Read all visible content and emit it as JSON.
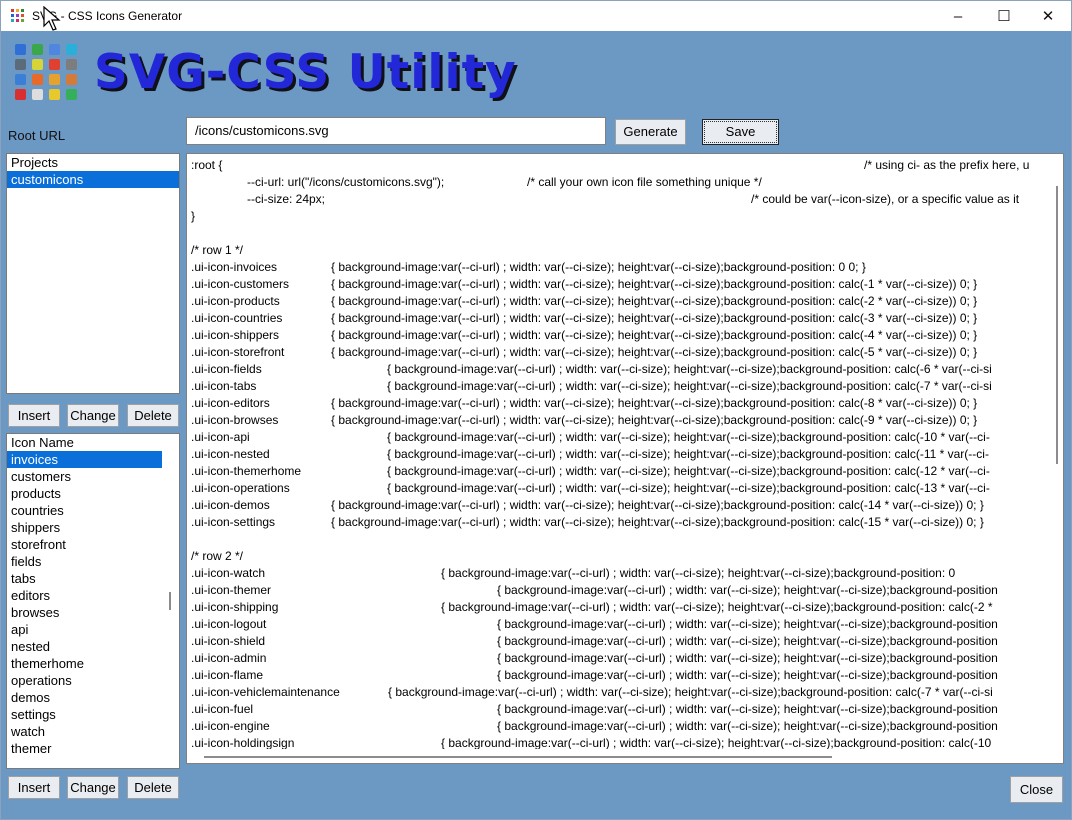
{
  "window": {
    "title": "SVG - CSS Icons Generator",
    "controls": {
      "minimize": "–",
      "maximize": "☐",
      "close": "✕"
    }
  },
  "hero": {
    "title": "SVG-CSS Utility"
  },
  "colors": {
    "background": "#6c98c4",
    "title": "#2227d8",
    "selection": "#0a6fd8"
  },
  "root_url": {
    "label": "Root URL",
    "value": "/icons/customicons.svg"
  },
  "buttons": {
    "generate": "Generate",
    "save": "Save",
    "insert": "Insert",
    "change": "Change",
    "delete": "Delete",
    "close": "Close"
  },
  "projects": {
    "items": [
      {
        "label": "Projects",
        "selected": false
      },
      {
        "label": "customicons",
        "selected": true
      }
    ]
  },
  "icons": {
    "items": [
      {
        "label": "Icon Name",
        "selected": false
      },
      {
        "label": "invoices",
        "selected": true
      },
      {
        "label": "customers",
        "selected": false
      },
      {
        "label": "products",
        "selected": false
      },
      {
        "label": "countries",
        "selected": false
      },
      {
        "label": "shippers",
        "selected": false
      },
      {
        "label": "storefront",
        "selected": false
      },
      {
        "label": "fields",
        "selected": false
      },
      {
        "label": "tabs",
        "selected": false
      },
      {
        "label": "editors",
        "selected": false
      },
      {
        "label": "browses",
        "selected": false
      },
      {
        "label": "api",
        "selected": false
      },
      {
        "label": "nested",
        "selected": false
      },
      {
        "label": "themerhome",
        "selected": false
      },
      {
        "label": "operations",
        "selected": false
      },
      {
        "label": "demos",
        "selected": false
      },
      {
        "label": "settings",
        "selected": false
      },
      {
        "label": "watch",
        "selected": false
      },
      {
        "label": "themer",
        "selected": false
      }
    ]
  },
  "code": {
    "lines": [
      {
        "indent": 0,
        "segs": [
          ":root {",
          "/* using ci- as the prefix here, u"
        ]
      },
      {
        "indent": 1,
        "segs": [
          "--ci-url: url(\"/icons/customicons.svg\");",
          "/* call your own icon file something unique */"
        ]
      },
      {
        "indent": 1,
        "segs": [
          "--ci-size: 24px;",
          "/* could be var(--icon-size), or a specific value as it"
        ]
      },
      {
        "indent": 0,
        "segs": [
          " }"
        ]
      },
      {
        "indent": 0,
        "segs": [
          ""
        ]
      },
      {
        "indent": 0,
        "segs": [
          "/* row 1 */"
        ]
      },
      {
        "indent": 0,
        "segs": [
          ".ui-icon-invoices",
          "{ background-image:var(--ci-url) ; width: var(--ci-size); height:var(--ci-size);background-position: 0 0; }"
        ]
      },
      {
        "indent": 0,
        "segs": [
          ".ui-icon-customers",
          "{ background-image:var(--ci-url) ; width: var(--ci-size); height:var(--ci-size);background-position: calc(-1 * var(--ci-size)) 0; }"
        ]
      },
      {
        "indent": 0,
        "segs": [
          ".ui-icon-products",
          "{ background-image:var(--ci-url) ; width: var(--ci-size); height:var(--ci-size);background-position: calc(-2 * var(--ci-size)) 0; }"
        ]
      },
      {
        "indent": 0,
        "segs": [
          ".ui-icon-countries",
          "{ background-image:var(--ci-url) ; width: var(--ci-size); height:var(--ci-size);background-position: calc(-3 * var(--ci-size)) 0; }"
        ]
      },
      {
        "indent": 0,
        "segs": [
          ".ui-icon-shippers",
          "{ background-image:var(--ci-url) ; width: var(--ci-size); height:var(--ci-size);background-position: calc(-4 * var(--ci-size)) 0; }"
        ]
      },
      {
        "indent": 0,
        "segs": [
          ".ui-icon-storefront",
          "{ background-image:var(--ci-url) ; width: var(--ci-size); height:var(--ci-size);background-position: calc(-5 * var(--ci-size)) 0; }"
        ]
      },
      {
        "indent": 0,
        "segs": [
          ".ui-icon-fields",
          "{ background-image:var(--ci-url) ; width: var(--ci-size); height:var(--ci-size);background-position: calc(-6 * var(--ci-si"
        ]
      },
      {
        "indent": 0,
        "segs": [
          ".ui-icon-tabs",
          "{ background-image:var(--ci-url) ; width: var(--ci-size); height:var(--ci-size);background-position: calc(-7 * var(--ci-si"
        ]
      },
      {
        "indent": 0,
        "segs": [
          ".ui-icon-editors",
          "{ background-image:var(--ci-url) ; width: var(--ci-size); height:var(--ci-size);background-position: calc(-8 * var(--ci-size)) 0; }"
        ]
      },
      {
        "indent": 0,
        "segs": [
          ".ui-icon-browses",
          "{ background-image:var(--ci-url) ; width: var(--ci-size); height:var(--ci-size);background-position: calc(-9 * var(--ci-size)) 0; }"
        ]
      },
      {
        "indent": 0,
        "segs": [
          ".ui-icon-api",
          "{ background-image:var(--ci-url) ; width: var(--ci-size); height:var(--ci-size);background-position: calc(-10 * var(--ci-"
        ]
      },
      {
        "indent": 0,
        "segs": [
          ".ui-icon-nested",
          "{ background-image:var(--ci-url) ; width: var(--ci-size); height:var(--ci-size);background-position: calc(-11 * var(--ci-"
        ]
      },
      {
        "indent": 0,
        "segs": [
          ".ui-icon-themerhome",
          "{ background-image:var(--ci-url) ; width: var(--ci-size); height:var(--ci-size);background-position: calc(-12 * var(--ci-"
        ]
      },
      {
        "indent": 0,
        "segs": [
          ".ui-icon-operations",
          "{ background-image:var(--ci-url) ; width: var(--ci-size); height:var(--ci-size);background-position: calc(-13 * var(--ci-"
        ]
      },
      {
        "indent": 0,
        "segs": [
          ".ui-icon-demos",
          "{ background-image:var(--ci-url) ; width: var(--ci-size); height:var(--ci-size);background-position: calc(-14 * var(--ci-size)) 0; }"
        ]
      },
      {
        "indent": 0,
        "segs": [
          ".ui-icon-settings",
          "{ background-image:var(--ci-url) ; width: var(--ci-size); height:var(--ci-size);background-position: calc(-15 * var(--ci-size)) 0; }"
        ]
      },
      {
        "indent": 0,
        "segs": [
          ""
        ]
      },
      {
        "indent": 0,
        "segs": [
          "/* row 2 */"
        ]
      },
      {
        "indent": 0,
        "segs": [
          ".ui-icon-watch",
          "{ background-image:var(--ci-url) ; width: var(--ci-size); height:var(--ci-size);background-position: 0"
        ]
      },
      {
        "indent": 0,
        "segs": [
          ".ui-icon-themer",
          "{ background-image:var(--ci-url) ; width: var(--ci-size); height:var(--ci-size);background-position"
        ]
      },
      {
        "indent": 0,
        "segs": [
          ".ui-icon-shipping",
          "{ background-image:var(--ci-url) ; width: var(--ci-size); height:var(--ci-size);background-position: calc(-2 *"
        ]
      },
      {
        "indent": 0,
        "segs": [
          ".ui-icon-logout",
          "{ background-image:var(--ci-url) ; width: var(--ci-size); height:var(--ci-size);background-position"
        ]
      },
      {
        "indent": 0,
        "segs": [
          ".ui-icon-shield",
          "{ background-image:var(--ci-url) ; width: var(--ci-size); height:var(--ci-size);background-position"
        ]
      },
      {
        "indent": 0,
        "segs": [
          ".ui-icon-admin",
          "{ background-image:var(--ci-url) ; width: var(--ci-size); height:var(--ci-size);background-position"
        ]
      },
      {
        "indent": 0,
        "segs": [
          ".ui-icon-flame",
          "{ background-image:var(--ci-url) ; width: var(--ci-size); height:var(--ci-size);background-position"
        ]
      },
      {
        "indent": 0,
        "segs": [
          ".ui-icon-vehiclemaintenance",
          "{ background-image:var(--ci-url) ; width: var(--ci-size); height:var(--ci-size);background-position: calc(-7 * var(--ci-si"
        ]
      },
      {
        "indent": 0,
        "segs": [
          ".ui-icon-fuel",
          "{ background-image:var(--ci-url) ; width: var(--ci-size); height:var(--ci-size);background-position"
        ]
      },
      {
        "indent": 0,
        "segs": [
          ".ui-icon-engine",
          "{ background-image:var(--ci-url) ; width: var(--ci-size); height:var(--ci-size);background-position"
        ]
      },
      {
        "indent": 0,
        "segs": [
          ".ui-icon-holdingsign",
          "{ background-image:var(--ci-url) ; width: var(--ci-size); height:var(--ci-size);background-position: calc(-10"
        ]
      }
    ]
  }
}
